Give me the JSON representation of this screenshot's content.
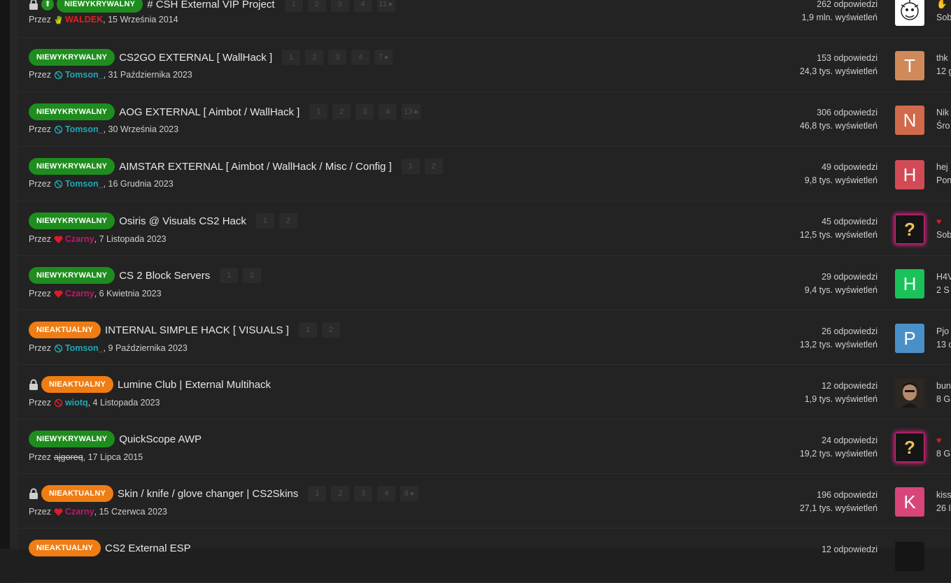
{
  "prefix": "Przez",
  "threads": [
    {
      "badge": "NIEWYKRYWALNY",
      "badge_color": "#1e8d1e",
      "title": "# CSH External VIP Project",
      "pages": [
        "1",
        "2",
        "3",
        "4",
        "11 ▸"
      ],
      "author": "WALDEK",
      "author_color": "#e02020",
      "author_icon": "hand-icon",
      "date": ", 15 Września 2014",
      "replies": "262 odpowiedzi",
      "views": "1,9 mln. wyświetleń",
      "avatar_letter": "",
      "avatar_color": "#ffffff",
      "last_user": "✋",
      "last_date": "Sob"
    },
    {
      "badge": "NIEWYKRYWALNY",
      "badge_color": "#1e8d1e",
      "title": "CS2GO EXTERNAL [ WallHack ]",
      "pages": [
        "1",
        "2",
        "3",
        "4",
        "7 ▸"
      ],
      "author": "Tomson_",
      "author_color": "#1fa8b5",
      "author_icon": "ban-icon",
      "date": ", 31 Października 2023",
      "replies": "153 odpowiedzi",
      "views": "24,3 tys. wyświetleń",
      "avatar_letter": "T",
      "avatar_color": "#d08a5a",
      "last_user": "thk",
      "last_date": "12 g"
    },
    {
      "badge": "NIEWYKRYWALNY",
      "badge_color": "#1e8d1e",
      "title": "AOG EXTERNAL [ Aimbot / WallHack ]",
      "pages": [
        "1",
        "2",
        "3",
        "4",
        "13 ▸"
      ],
      "author": "Tomson_",
      "author_color": "#1fa8b5",
      "author_icon": "ban-icon",
      "date": ", 30 Września 2023",
      "replies": "306 odpowiedzi",
      "views": "46,8 tys. wyświetleń",
      "avatar_letter": "N",
      "avatar_color": "#d06a4a",
      "last_user": "Nik",
      "last_date": "Śro"
    },
    {
      "badge": "NIEWYKRYWALNY",
      "badge_color": "#1e8d1e",
      "title": "AIMSTAR EXTERNAL [ Aimbot / WallHack / Misc / Config ]",
      "pages": [
        "1",
        "2"
      ],
      "author": "Tomson_",
      "author_color": "#1fa8b5",
      "author_icon": "ban-icon",
      "date": ", 16 Grudnia 2023",
      "replies": "49 odpowiedzi",
      "views": "9,8 tys. wyświetleń",
      "avatar_letter": "H",
      "avatar_color": "#d24a55",
      "last_user": "hej",
      "last_date": "Pon"
    },
    {
      "badge": "NIEWYKRYWALNY",
      "badge_color": "#1e8d1e",
      "title": "Osiris @ Visuals CS2 Hack",
      "pages": [
        "1",
        "2"
      ],
      "author": "Czarny",
      "author_color": "#c0186a",
      "author_icon": "heart-icon",
      "date": ", 7 Listopada 2023",
      "replies": "45 odpowiedzi",
      "views": "12,5 tys. wyświetleń",
      "avatar_letter": "?",
      "avatar_color": "#151515",
      "last_user": "♥",
      "last_date": "Sob"
    },
    {
      "badge": "NIEWYKRYWALNY",
      "badge_color": "#1e8d1e",
      "title": "CS 2 Block Servers",
      "pages": [
        "1",
        "2"
      ],
      "author": "Czarny",
      "author_color": "#c0186a",
      "author_icon": "heart-icon",
      "date": ", 6 Kwietnia 2023",
      "replies": "29 odpowiedzi",
      "views": "9,4 tys. wyświetleń",
      "avatar_letter": "H",
      "avatar_color": "#1ac25a",
      "last_user": "H4V",
      "last_date": "2 S"
    },
    {
      "badge": "NIEAKTUALNY",
      "badge_color": "#f07d14",
      "title": "INTERNAL SIMPLE HACK [ VISUALS ]",
      "pages": [
        "1",
        "2"
      ],
      "author": "Tomson_",
      "author_color": "#1fa8b5",
      "author_icon": "ban-icon",
      "date": ", 9 Października 2023",
      "replies": "26 odpowiedzi",
      "views": "13,2 tys. wyświetleń",
      "avatar_letter": "P",
      "avatar_color": "#4a90c8",
      "last_user": "Pjo",
      "last_date": "13 c"
    },
    {
      "badge": "NIEAKTUALNY",
      "badge_color": "#f07d14",
      "title": "Lumine Club | External Multihack",
      "pages": [],
      "author": "wiotq",
      "author_color": "#1fa8b5",
      "author_icon": "ban-red-icon",
      "date": ", 4 Listopada 2023",
      "replies": "12 odpowiedzi",
      "views": "1,9 tys. wyświetleń",
      "avatar_letter": "",
      "avatar_color": "#3a3028",
      "last_user": "bun",
      "last_date": "8 G"
    },
    {
      "badge": "NIEWYKRYWALNY",
      "badge_color": "#1e8d1e",
      "title": "QuickScope AWP",
      "pages": [],
      "author": "ajgoreq",
      "author_color": "#cfcfcf",
      "author_icon": "",
      "date": ", 17 Lipca 2015",
      "replies": "24 odpowiedzi",
      "views": "19,2 tys. wyświetleń",
      "avatar_letter": "?",
      "avatar_color": "#151515",
      "last_user": "♥",
      "last_date": "8 G"
    },
    {
      "badge": "NIEAKTUALNY",
      "badge_color": "#f07d14",
      "title": "Skin / knife / glove changer | CS2Skins",
      "pages": [
        "1",
        "2",
        "3",
        "4",
        "8 ▸"
      ],
      "author": "Czarny",
      "author_color": "#c0186a",
      "author_icon": "heart-icon",
      "date": ", 15 Czerwca 2023",
      "replies": "196 odpowiedzi",
      "views": "27,1 tys. wyświetleń",
      "avatar_letter": "K",
      "avatar_color": "#d8457a",
      "last_user": "kiss",
      "last_date": "26 I"
    },
    {
      "badge": "NIEAKTUALNY",
      "badge_color": "#f07d14",
      "title": "CS2 External ESP",
      "pages": [],
      "author": "",
      "author_color": "#cfcfcf",
      "author_icon": "",
      "date": "",
      "replies": "12 odpowiedzi",
      "views": "",
      "avatar_letter": "",
      "avatar_color": "#151515",
      "last_user": "",
      "last_date": ""
    }
  ]
}
